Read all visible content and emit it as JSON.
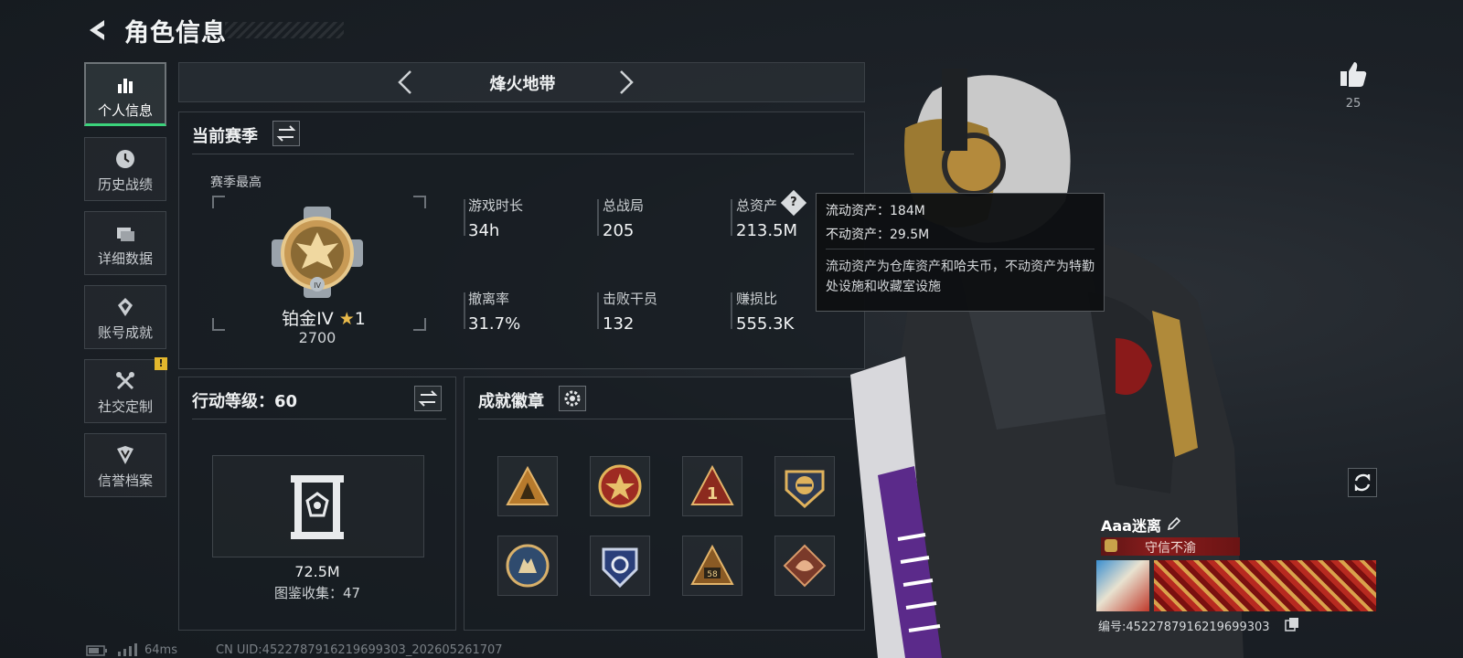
{
  "header": {
    "title": "角色信息"
  },
  "sidebar": {
    "items": [
      {
        "label": "个人信息",
        "icon": "bar-chart-icon",
        "active": true
      },
      {
        "label": "历史战绩",
        "icon": "clock-icon"
      },
      {
        "label": "详细数据",
        "icon": "folder-icon"
      },
      {
        "label": "账号成就",
        "icon": "achievement-icon"
      },
      {
        "label": "社交定制",
        "icon": "tools-icon",
        "alert": "!"
      },
      {
        "label": "信誉档案",
        "icon": "shield-icon"
      }
    ]
  },
  "mode": {
    "label": "烽火地带"
  },
  "season": {
    "title": "当前赛季",
    "best_label": "赛季最高",
    "rank_name": "铂金IV",
    "rank_stars": "1",
    "rank_score": "2700",
    "stats": [
      {
        "label": "游戏时长",
        "value": "34h"
      },
      {
        "label": "总战局",
        "value": "205"
      },
      {
        "label": "总资产",
        "value": "213.5M",
        "help": "?"
      },
      {
        "label": "撤离率",
        "value": "31.7%"
      },
      {
        "label": "击败干员",
        "value": "132"
      },
      {
        "label": "赚损比",
        "value": "555.3K"
      }
    ]
  },
  "tooltip": {
    "liquid": "流动资产：184M",
    "fixed": "不动资产：29.5M",
    "desc": "流动资产为仓库资产和哈夫币，不动资产为特勤处设施和收藏室设施"
  },
  "action": {
    "title": "行动等级：60",
    "collection_value": "72.5M",
    "collection_label": "图鉴收集：47"
  },
  "achievements": {
    "title": "成就徽章",
    "badges": [
      "triangle-squad-badge",
      "star-seal-badge",
      "rank-one-badge",
      "gold-emblem-badge",
      "wolf-round-badge",
      "blue-shield-badge",
      "number-58-badge",
      "dragon-badge"
    ]
  },
  "profile": {
    "likes": "25",
    "name": "Aaa迷离",
    "title_tag": "守信不渝",
    "id_text": "编号:4522787916219699303"
  },
  "footer": {
    "ping": "64ms",
    "uid": "CN UID:4522787916219699303_202605261707"
  },
  "colors": {
    "accent_green": "#3bd37b",
    "warn_yellow": "#e3b72d",
    "tag_red": "#8a1c1c"
  }
}
